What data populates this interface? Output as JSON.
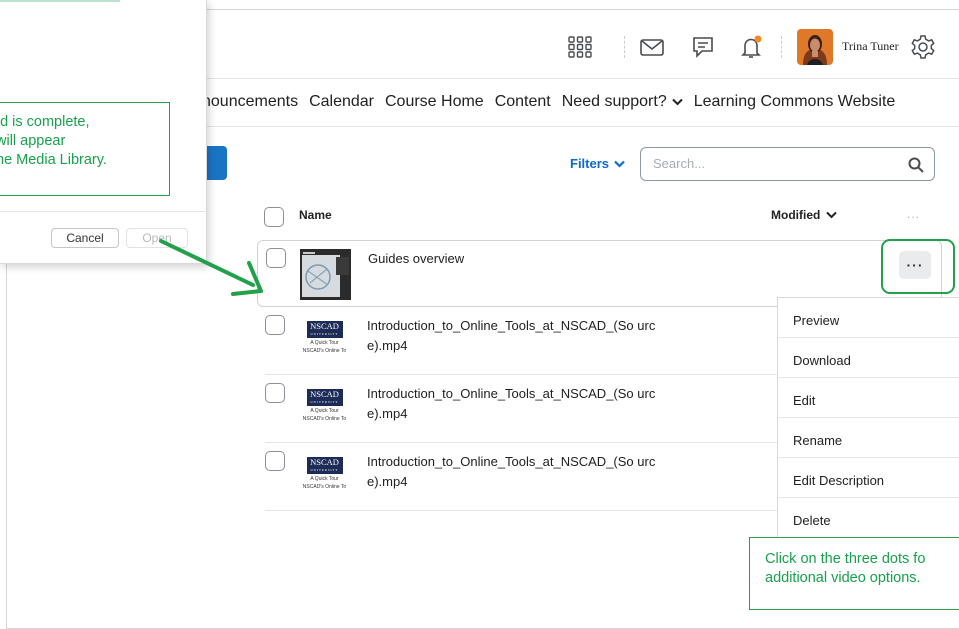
{
  "dialog": {
    "cancel_label": "Cancel",
    "open_label": "Open"
  },
  "callouts": {
    "upload_lines": [
      "ad is complete,",
      "will appear",
      "he Media Library."
    ],
    "dots_lines": [
      "Click on the three dots fo",
      "additional video options."
    ]
  },
  "header": {
    "user_name": "Trina Tuner",
    "notification_color": "#f08a24"
  },
  "nav": {
    "items": [
      "nouncements",
      "Calendar",
      "Course Home",
      "Content",
      "Need support?",
      "Learning Commons Website"
    ]
  },
  "toolbar": {
    "filters_label": "Filters",
    "search_placeholder": "Search..."
  },
  "table": {
    "columns": {
      "name": "Name",
      "modified": "Modified",
      "more": "..."
    },
    "rows": [
      {
        "title": "Guides overview",
        "thumb": "guides-thumbnail"
      },
      {
        "title": "Introduction_to_Online_Tools_at_NSCAD_(So urce).mp4",
        "thumb": "nscad-thumbnail"
      },
      {
        "title": "Introduction_to_Online_Tools_at_NSCAD_(So urce).mp4",
        "thumb": "nscad-thumbnail"
      },
      {
        "title": "Introduction_to_Online_Tools_at_NSCAD_(So urce).mp4",
        "thumb": "nscad-thumbnail"
      }
    ],
    "thumb_text": {
      "logo": "NSCAD",
      "logo_sub": "UNIVERSITY",
      "caption_1": "A Quick Tour",
      "caption_2": "NSCAD's Online To"
    }
  },
  "more_button": {
    "label": "···"
  },
  "menu": {
    "items": [
      "Preview",
      "Download",
      "Edit",
      "Rename",
      "Edit Description",
      "Delete"
    ]
  },
  "colors": {
    "accent": "#1a74c4",
    "callout_green": "#22a04a"
  }
}
